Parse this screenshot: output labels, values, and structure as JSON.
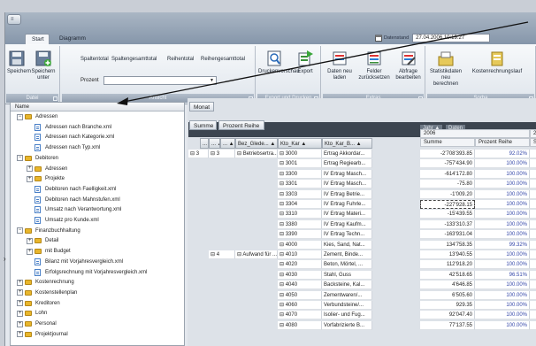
{
  "app": {
    "menu_icon": "≡",
    "tabs": [
      "Start",
      "Diagramm"
    ],
    "timestamp_label": "Datenstand",
    "timestamp": "27.04.2006 10:19:27"
  },
  "ribbon": {
    "groups": [
      "Datei",
      "Ansicht",
      "Export und Drucken",
      "Extras",
      "Sorba"
    ],
    "datei": [
      "Speichern",
      "Speichern unter"
    ],
    "ansicht_tabs": [
      "Spaltentotal",
      "Spaltengesamttotal",
      "Reihentotal",
      "Reihengesamttotal"
    ],
    "prozent_label": "Prozent",
    "export": [
      "Druckenvorschau",
      "Export"
    ],
    "extras": [
      "Daten neu laden",
      "Felder zurücksetzen",
      "Abfrage bearbeiten"
    ],
    "sorba": [
      "Statistikdaten neu berechnen",
      "Kostenrechnungslauf"
    ]
  },
  "tree": {
    "header": "Name",
    "rows": [
      {
        "t": "Adressen",
        "lvl": 0,
        "type": "folder",
        "exp": "−"
      },
      {
        "t": "Adressen nach Branche.xml",
        "lvl": 1,
        "type": "doc"
      },
      {
        "t": "Adressen nach Kategorie.xml",
        "lvl": 1,
        "type": "doc"
      },
      {
        "t": "Adressen nach Typ.xml",
        "lvl": 1,
        "type": "doc"
      },
      {
        "t": "Debitoren",
        "lvl": 0,
        "type": "folder",
        "exp": "−"
      },
      {
        "t": "Adressen",
        "lvl": 1,
        "type": "folder",
        "exp": "+"
      },
      {
        "t": "Projekte",
        "lvl": 1,
        "type": "folder",
        "exp": "+"
      },
      {
        "t": "Debitoren nach Faelligkeit.xml",
        "lvl": 1,
        "type": "doc"
      },
      {
        "t": "Debitoren nach Mahnstufen.xml",
        "lvl": 1,
        "type": "doc"
      },
      {
        "t": "Umsatz nach Verantwortung.xml",
        "lvl": 1,
        "type": "doc"
      },
      {
        "t": "Umsatz pro Kunde.xml",
        "lvl": 1,
        "type": "doc"
      },
      {
        "t": "Finanzbuchhaltung",
        "lvl": 0,
        "type": "folder",
        "exp": "−"
      },
      {
        "t": "Detail",
        "lvl": 1,
        "type": "folder",
        "exp": "+"
      },
      {
        "t": "mit Budget",
        "lvl": 1,
        "type": "folder",
        "exp": "+"
      },
      {
        "t": "Bilanz mit Vorjahresvergleich.xml",
        "lvl": 1,
        "type": "doc"
      },
      {
        "t": "Erfolgsrechnung mit Vorjahresvergleich.xml",
        "lvl": 1,
        "type": "doc"
      },
      {
        "t": "Kostenrechnung",
        "lvl": 0,
        "type": "folder",
        "exp": "+"
      },
      {
        "t": "Kostenstellenplan",
        "lvl": 0,
        "type": "folder",
        "exp": "+"
      },
      {
        "t": "Kreditoren",
        "lvl": 0,
        "type": "folder",
        "exp": "+"
      },
      {
        "t": "Lohn",
        "lvl": 0,
        "type": "folder",
        "exp": "+"
      },
      {
        "t": "Personal",
        "lvl": 0,
        "type": "folder",
        "exp": "+"
      },
      {
        "t": "Projektjournal",
        "lvl": 0,
        "type": "folder",
        "exp": "+"
      }
    ]
  },
  "pivot": {
    "filter": "Monat",
    "summe": "Summe",
    "prozent_reihe": "Prozent Reihe",
    "col_fields": [
      "Jahr",
      "Daten"
    ],
    "year": "2006",
    "year2": "20",
    "measure_cols": [
      "Summe",
      "Prozent Reihe",
      "Su"
    ],
    "row_fields": [
      "...",
      "...",
      "...",
      "Bez_Glede...",
      "Kto_Kar",
      "Kto_Kar_B..."
    ],
    "groups": [
      {
        "a": "3",
        "b": "3",
        "c": "Betriebsertra..."
      },
      {
        "c2": "4",
        "d": "Aufwand für ..."
      }
    ],
    "rows": [
      [
        "3000",
        "Ertrag Akkordar...",
        "-2'708'393.85",
        "92.02%"
      ],
      [
        "3001",
        "Ertrag Regiearb...",
        "-757'434.90",
        "100.00%"
      ],
      [
        "3300",
        "IV Ertrag Masch...",
        "-614'172.80",
        "100.00%"
      ],
      [
        "3301",
        "IV Ertrag Masch...",
        "-75.80",
        "100.00%"
      ],
      [
        "3303",
        "IV Ertrag Betrie...",
        "-1'009.20",
        "100.00%"
      ],
      [
        "3304",
        "IV Ertrag Fuhrle...",
        "-227'928.15",
        "100.00%"
      ],
      [
        "3310",
        "IV Ertrag Materi...",
        "-15'439.55",
        "100.00%"
      ],
      [
        "3380",
        "IV Ertrag Kaufm...",
        "-133'310.37",
        "100.00%"
      ],
      [
        "3390",
        "IV Ertrag Techn...",
        "-163'931.04",
        "100.00%"
      ],
      [
        "4000",
        "Kies, Sand, Nat...",
        "134'758.35",
        "99.32%"
      ],
      [
        "4010",
        "Zement, Binde...",
        "13'940.55",
        "100.00%"
      ],
      [
        "4020",
        "Beton, Mörtel, ...",
        "112'918.20",
        "100.00%"
      ],
      [
        "4030",
        "Stahl, Guss",
        "42'518.65",
        "96.51%"
      ],
      [
        "4040",
        "Backsteine, Kal...",
        "4'646.85",
        "100.00%"
      ],
      [
        "4050",
        "Zementwaren/...",
        "6'505.60",
        "100.00%"
      ],
      [
        "4060",
        "Verbundsteine/...",
        "929.35",
        "100.00%"
      ],
      [
        "4070",
        "Isolier- und Fug...",
        "92'047.40",
        "100.00%"
      ],
      [
        "4080",
        "Vorfabrizierte B...",
        "77'137.55",
        "100.00%"
      ]
    ]
  }
}
